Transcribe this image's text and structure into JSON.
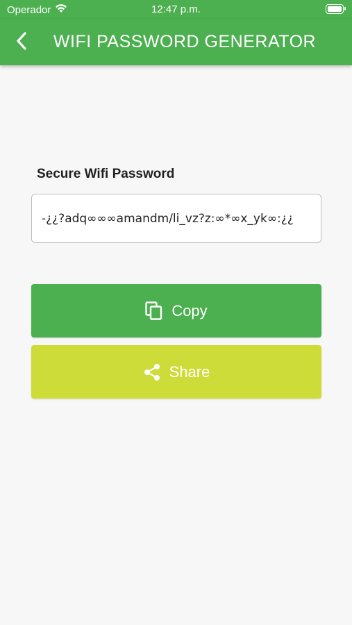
{
  "status_bar": {
    "carrier": "Operador",
    "time": "12:47 p.m.",
    "wifi_icon": "wifi-icon",
    "battery_icon": "battery-icon"
  },
  "app_bar": {
    "back_icon": "chevron-left-icon",
    "title": "WIFI PASSWORD GENERATOR"
  },
  "main": {
    "label": "Secure Wifi Password",
    "password_value": "-¿¿?adq∞∞∞amandm/li_vz?z:∞*∞x_yk∞:¿¿",
    "copy_button": {
      "label": "Copy",
      "icon": "copy-icon"
    },
    "share_button": {
      "label": "Share",
      "icon": "share-icon"
    }
  },
  "colors": {
    "primary": "#4caf50",
    "share": "#cddc39",
    "background": "#f7f7f7"
  }
}
